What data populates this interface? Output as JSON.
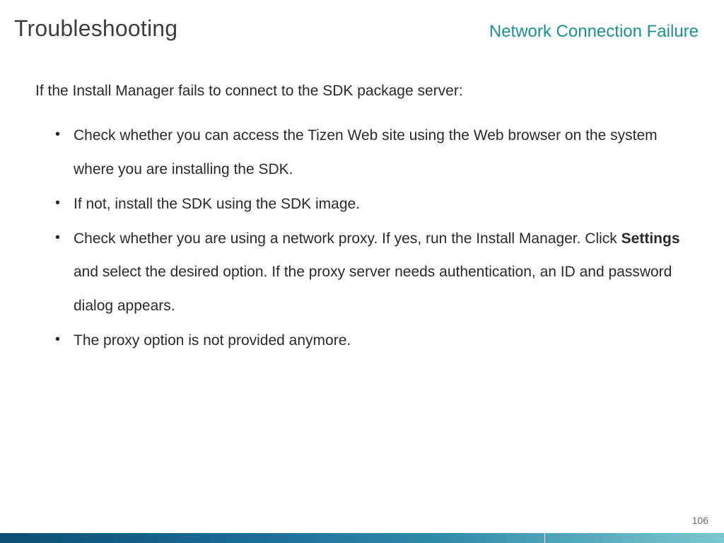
{
  "header": {
    "title": "Troubleshooting",
    "subtitle": "Network Connection Failure"
  },
  "content": {
    "lead": "If the Install Manager fails to connect to the SDK package server:",
    "bullets": [
      {
        "pre": "Check whether you can access the Tizen Web site using the Web browser on the system where you are installing the SDK."
      },
      {
        "pre": "If not, install the SDK using the SDK image."
      },
      {
        "pre": "Check whether you are using a network proxy. If yes, run the Install Manager. Click ",
        "bold": "Settings",
        "post": " and select the desired option. If the proxy server needs authentication, an ID and password dialog appears."
      },
      {
        "pre": "The proxy option is not provided anymore."
      }
    ]
  },
  "page_number": "106"
}
